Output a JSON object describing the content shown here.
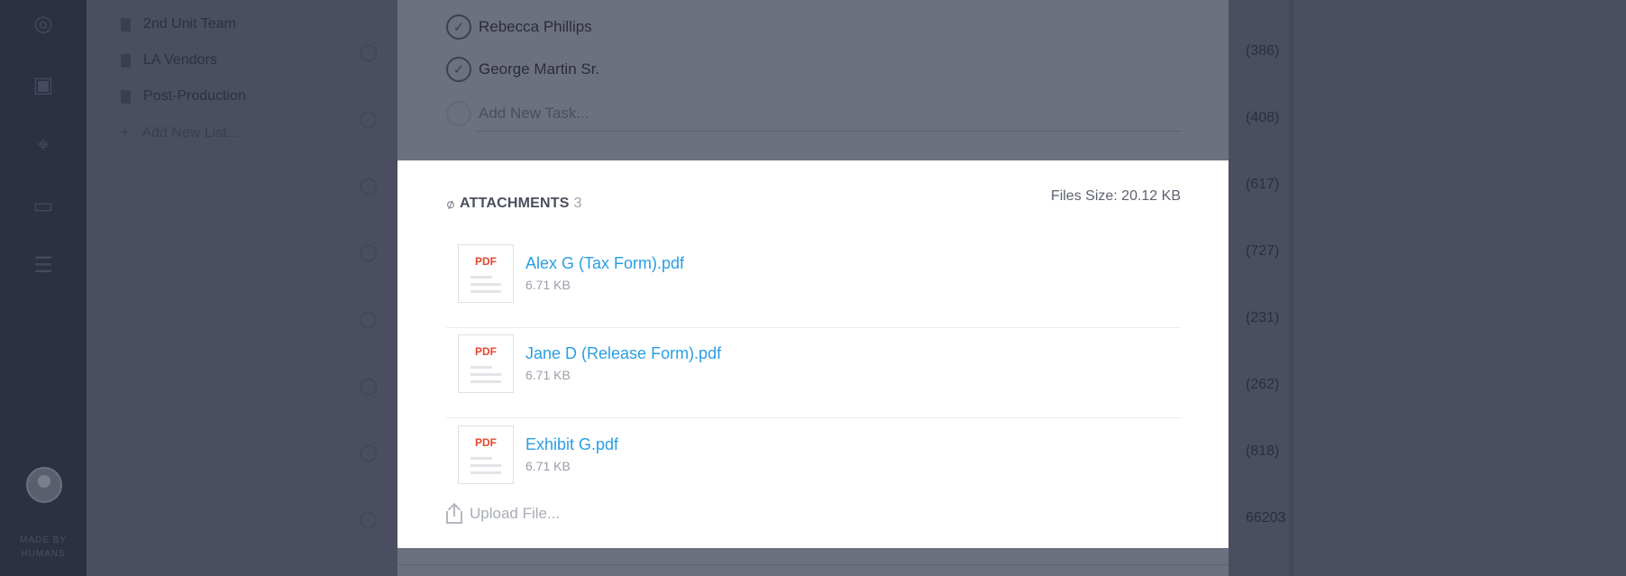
{
  "sidebar": {
    "icons": [
      "globe-icon",
      "calendar-icon",
      "location-pin-icon",
      "folder-icon",
      "sliders-icon"
    ],
    "footer_line1": "MADE BY",
    "footer_line2": "HUMANS"
  },
  "lists": {
    "items": [
      {
        "label": "2nd Unit Team"
      },
      {
        "label": "LA Vendors"
      },
      {
        "label": "Post-Production"
      }
    ],
    "add_label": "Add New List..."
  },
  "background_counts": [
    "(386)",
    "(408)",
    "(617)",
    "(727)",
    "(231)",
    "(262)",
    "(818)",
    "66203"
  ],
  "modal": {
    "tasks": [
      {
        "label": "Rebecca Phillips",
        "done": true
      },
      {
        "label": "George Martin Sr.",
        "done": true
      }
    ],
    "add_task_placeholder": "Add New Task...",
    "attachments": {
      "title": "ATTACHMENTS",
      "count": "3",
      "files_size": "Files Size: 20.12 KB",
      "files": [
        {
          "type": "PDF",
          "name": "Alex G (Tax Form).pdf",
          "size": "6.71 KB"
        },
        {
          "type": "PDF",
          "name": "Jane D (Release Form).pdf",
          "size": "6.71 KB"
        },
        {
          "type": "PDF",
          "name": "Exhibit G.pdf",
          "size": "6.71 KB"
        }
      ],
      "upload_label": "Upload File..."
    }
  },
  "colors": {
    "link": "#2a9ee3",
    "pdf_tag": "#e8462c",
    "overlay": "#4c5062"
  }
}
